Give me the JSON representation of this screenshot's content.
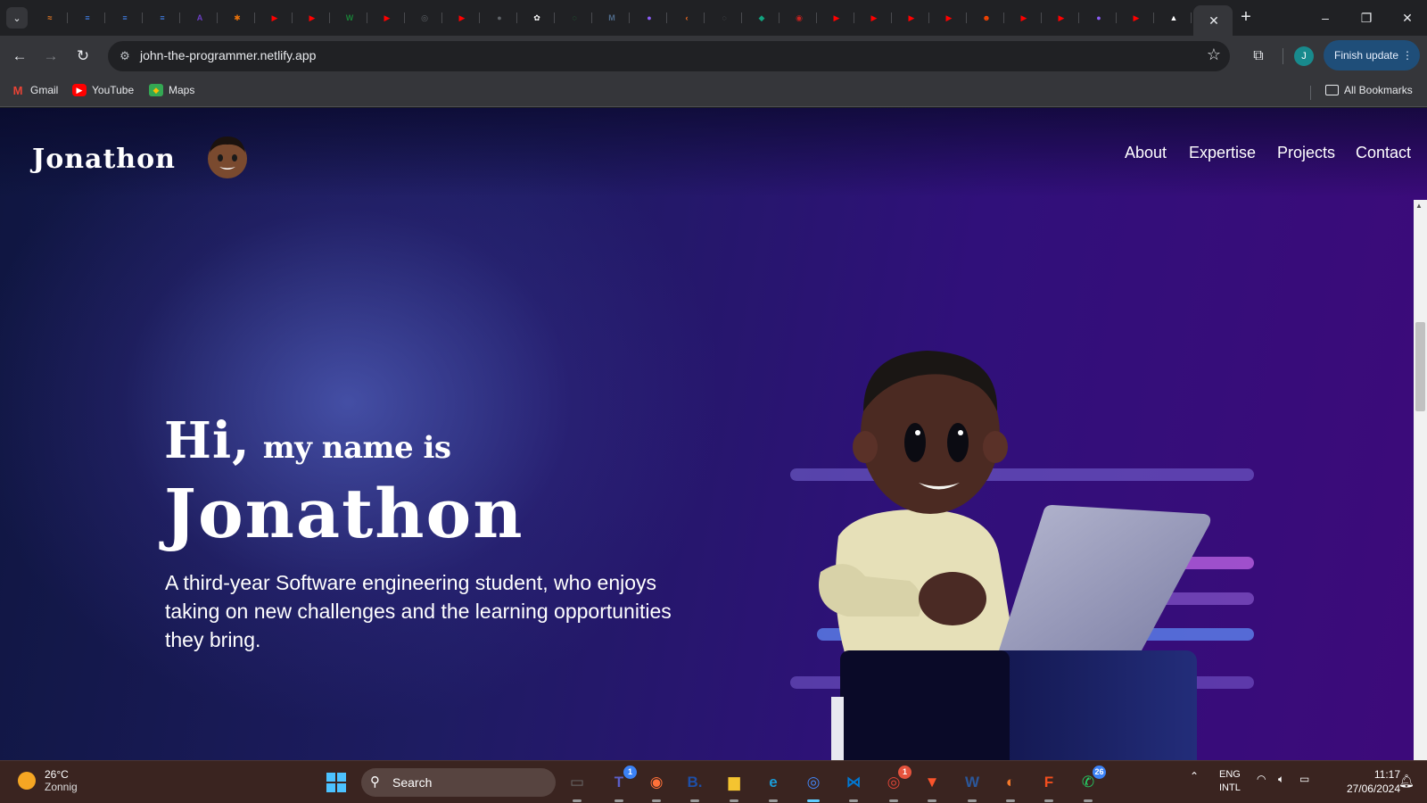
{
  "browser": {
    "url": "john-the-programmer.netlify.app",
    "finish_update": "Finish update",
    "profile_initial": "J",
    "bookmarks": [
      {
        "label": "Gmail",
        "icon": "gmail-icon",
        "color": "#ea4335"
      },
      {
        "label": "YouTube",
        "icon": "youtube-icon",
        "color": "#ff0000"
      },
      {
        "label": "Maps",
        "icon": "maps-icon",
        "color": "#34a853"
      }
    ],
    "all_bookmarks": "All Bookmarks",
    "tabs": [
      {
        "icon": "stackoverflow-like-icon",
        "color": "#f48024",
        "glyph": "≈"
      },
      {
        "icon": "google-docs-icon",
        "color": "#4285f4",
        "glyph": "≡"
      },
      {
        "icon": "google-docs-icon",
        "color": "#4285f4",
        "glyph": "≡"
      },
      {
        "icon": "google-docs-icon",
        "color": "#4285f4",
        "glyph": "≡"
      },
      {
        "icon": "purple-a-icon",
        "color": "#6c3fc5",
        "glyph": "A"
      },
      {
        "icon": "asterisk-icon",
        "color": "#e8710a",
        "glyph": "✱"
      },
      {
        "icon": "youtube-icon",
        "color": "#ff0000",
        "glyph": "▶"
      },
      {
        "icon": "youtube-icon",
        "color": "#ff0000",
        "glyph": "▶"
      },
      {
        "icon": "webflow-w-icon",
        "color": "#1a7f37",
        "glyph": "W"
      },
      {
        "icon": "youtube-icon",
        "color": "#ff0000",
        "glyph": "▶"
      },
      {
        "icon": "circle-target-icon",
        "color": "#5f6368",
        "glyph": "◎"
      },
      {
        "icon": "youtube-icon",
        "color": "#ff0000",
        "glyph": "▶"
      },
      {
        "icon": "globe-icon",
        "color": "#5f6368",
        "glyph": "●"
      },
      {
        "icon": "openai-icon",
        "color": "#ffffff",
        "glyph": "✿"
      },
      {
        "icon": "green-circle-icon",
        "color": "#1e8e3e",
        "glyph": "◌"
      },
      {
        "icon": "m-circle-icon",
        "color": "#4f6b8a",
        "glyph": "M"
      },
      {
        "icon": "gradient-orb-icon",
        "color": "#8a5cf6",
        "glyph": "●"
      },
      {
        "icon": "orange-arrow-icon",
        "color": "#f36c21",
        "glyph": "‹"
      },
      {
        "icon": "circle-arrow-icon",
        "color": "#5f6368",
        "glyph": "◌"
      },
      {
        "icon": "green-diamond-icon",
        "color": "#12a37f",
        "glyph": "◆"
      },
      {
        "icon": "record-icon",
        "color": "#c5221f",
        "glyph": "◉"
      },
      {
        "icon": "youtube-icon",
        "color": "#ff0000",
        "glyph": "▶"
      },
      {
        "icon": "youtube-icon",
        "color": "#ff0000",
        "glyph": "▶"
      },
      {
        "icon": "youtube-icon",
        "color": "#ff0000",
        "glyph": "▶"
      },
      {
        "icon": "youtube-icon",
        "color": "#ff0000",
        "glyph": "▶"
      },
      {
        "icon": "reddit-icon",
        "color": "#ff4500",
        "glyph": "☻"
      },
      {
        "icon": "youtube-icon",
        "color": "#ff0000",
        "glyph": "▶"
      },
      {
        "icon": "youtube-icon",
        "color": "#ff0000",
        "glyph": "▶"
      },
      {
        "icon": "gradient-orb-icon",
        "color": "#8a5cf6",
        "glyph": "●"
      },
      {
        "icon": "youtube-icon",
        "color": "#ff0000",
        "glyph": "▶"
      },
      {
        "icon": "triangle-icon",
        "color": "#ffffff",
        "glyph": "▲"
      }
    ]
  },
  "site": {
    "logo": "Jonathon",
    "nav": [
      "About",
      "Expertise",
      "Projects",
      "Contact"
    ],
    "greeting_hi": "Hi,",
    "greeting_rest": "my name is",
    "name": "Jonathon",
    "description": "A third-year Software engineering student, who enjoys taking on new challenges and the learning opportunities they bring."
  },
  "taskbar": {
    "temp": "26°C",
    "condition": "Zonnig",
    "search_placeholder": "Search",
    "apps": [
      {
        "name": "task-view-icon",
        "color": "#6b6b6b",
        "glyph": "▭"
      },
      {
        "name": "teams-icon",
        "color": "#5b5fc7",
        "glyph": "T",
        "badge": "1"
      },
      {
        "name": "firefox-icon",
        "color": "#ff7139",
        "glyph": "◉"
      },
      {
        "name": "b-app-icon",
        "color": "#1e4fa8",
        "glyph": "B."
      },
      {
        "name": "file-explorer-icon",
        "color": "#f4c430",
        "glyph": "▆"
      },
      {
        "name": "edge-icon",
        "color": "#1a9bd7",
        "glyph": "e"
      },
      {
        "name": "chrome-icon",
        "color": "#4285f4",
        "glyph": "◎",
        "active": true
      },
      {
        "name": "vscode-icon",
        "color": "#0078d4",
        "glyph": "⋈"
      },
      {
        "name": "chrome-alt-icon",
        "color": "#db4437",
        "glyph": "◎",
        "badge_red": "1"
      },
      {
        "name": "brave-icon",
        "color": "#fb542b",
        "glyph": "▼"
      },
      {
        "name": "word-icon",
        "color": "#2b579a",
        "glyph": "W"
      },
      {
        "name": "blender-icon",
        "color": "#f5792a",
        "glyph": "◐"
      },
      {
        "name": "figma-icon",
        "color": "#f24e1e",
        "glyph": "F"
      },
      {
        "name": "whatsapp-icon",
        "color": "#25d366",
        "glyph": "✆",
        "badge": "26"
      }
    ],
    "lang_top": "ENG",
    "lang_bottom": "INTL",
    "time": "11:17",
    "date": "27/06/2024"
  }
}
